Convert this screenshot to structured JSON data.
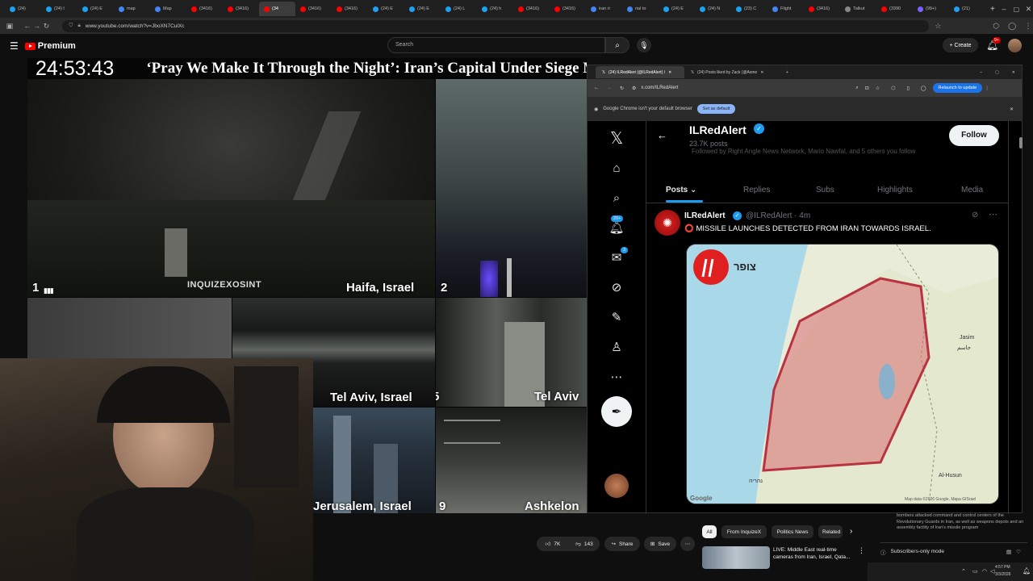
{
  "browser": {
    "tabs": [
      {
        "label": "(24)",
        "color": "#1da1f2"
      },
      {
        "label": "(24) I",
        "color": "#1da1f2"
      },
      {
        "label": "(24) E",
        "color": "#1da1f2"
      },
      {
        "label": "map",
        "color": "#4285f4"
      },
      {
        "label": "Map",
        "color": "#4285f4"
      },
      {
        "label": "(3416)",
        "color": "#ff0000"
      },
      {
        "label": "(3416)",
        "color": "#ff0000"
      },
      {
        "label": "(34",
        "color": "#ff0000",
        "active": true
      },
      {
        "label": "(3416)",
        "color": "#ff0000"
      },
      {
        "label": "(3416)",
        "color": "#ff0000"
      },
      {
        "label": "(24) E",
        "color": "#1da1f2"
      },
      {
        "label": "(24) E",
        "color": "#1da1f2"
      },
      {
        "label": "(24) L",
        "color": "#1da1f2"
      },
      {
        "label": "(24) h",
        "color": "#1da1f2"
      },
      {
        "label": "(3416)",
        "color": "#ff0000"
      },
      {
        "label": "(3416)",
        "color": "#ff0000"
      },
      {
        "label": "iran ri",
        "color": "#4285f4"
      },
      {
        "label": "rial to",
        "color": "#4285f4"
      },
      {
        "label": "(24) E",
        "color": "#1da1f2"
      },
      {
        "label": "(24) N",
        "color": "#1da1f2"
      },
      {
        "label": "(23) C",
        "color": "#1da1f2"
      },
      {
        "label": "Flight",
        "color": "#4285f4"
      },
      {
        "label": "(3416)",
        "color": "#ff0000"
      },
      {
        "label": "Talkut",
        "color": "#888888"
      },
      {
        "label": "(3390",
        "color": "#ff0000"
      },
      {
        "label": "(99+)",
        "color": "#7b61ff"
      },
      {
        "label": "(21)",
        "color": "#1da1f2"
      }
    ],
    "url": "www.youtube.com/watch?v=JboXN7CulXc"
  },
  "youtube": {
    "logo_label": "Premium",
    "search_placeholder": "Search",
    "create_label": "Create",
    "notif_count": "9+",
    "clock": "24:53:43",
    "video_title": "‘Pray We Make It Through the Night’: Iran’s Capital Under Siege M",
    "watermark": "INQUIZEXOSINT",
    "cams": [
      {
        "num": "1",
        "label": "Haifa, Israel"
      },
      {
        "num": "2",
        "label": ""
      },
      {
        "num": "",
        "label": "Tel Aviv, Israel"
      },
      {
        "num": "5",
        "label": "Tel Aviv"
      },
      {
        "num": "",
        "label": "Jerusalem, Israel"
      },
      {
        "num": "9",
        "label": "Ashkelon"
      }
    ],
    "likes": "7K",
    "dislikes": "143",
    "share_label": "Share",
    "save_label": "Save",
    "chips": [
      "All",
      "From InquizeX",
      "Politics News",
      "Related"
    ],
    "rec_title": "LIVE: Middle East real-time cameras from Iran, Israel, Qata...",
    "desc_text": "bombers attacked command and control centers of the Revolutionary Guards in Iran, as well as weapons depots and an assembly facility of Iran's missile program",
    "chat_mode": "Subscribers-only mode"
  },
  "x_window": {
    "tabs": [
      "(24) ILRedAlert (@ILRedAlert) /",
      "(24) Posts liked by Zack (@Asmo"
    ],
    "url": "x.com/ILRedAlert",
    "relaunch_label": "Relaunch to update",
    "info_text": "Google Chrome isn't your default browser",
    "set_default_label": "Set as default",
    "profile_name": "ILRedAlert",
    "post_count": "23.7K posts",
    "followed_by": "Followed by Right Angle News Network, Mario Nawfal, and 5 others you follow",
    "follow_label": "Follow",
    "profile_tabs": [
      "Posts",
      "Replies",
      "Subs",
      "Highlights",
      "Media"
    ],
    "notif_badge": "20+",
    "msg_badge": "3",
    "tweet": {
      "name": "ILRedAlert",
      "handle": "@ILRedAlert · 4m",
      "text": "⭕ MISSILE LAUNCHES DETECTED FROM IRAN TOWARDS ISRAEL."
    },
    "map": {
      "app_label": "צופר",
      "places": [
        "Jasim",
        "جاسم",
        "Al-Husun",
        "נהריה"
      ],
      "google": "Google",
      "credit": "Map data ©2026 Google, Mapa GISrael"
    }
  },
  "taskbar": {
    "time": "4:57 PM",
    "date": "3/3/2026"
  }
}
